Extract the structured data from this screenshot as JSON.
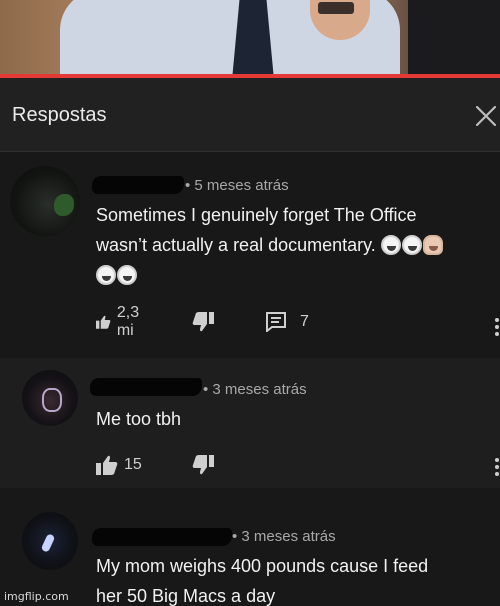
{
  "panel": {
    "title": "Respostas"
  },
  "comments": [
    {
      "meta": "• 5 meses atrás",
      "text_line1": "Sometimes I genuinely forget The Office",
      "text_line2": "wasn’t actually a real documentary.",
      "emoji": [
        "grinning-sweat-emoji",
        "grinning-sweat-emoji",
        "person-shrugging-emoji",
        "grinning-sweat-emoji",
        "grinning-sweat-emoji"
      ],
      "likes": "2,3 mi",
      "replies": "7"
    },
    {
      "meta": "• 3 meses atrás",
      "text_line1": "Me too tbh",
      "likes": "15"
    },
    {
      "meta": "• 3 meses atrás",
      "text_line1": "My mom weighs 400 pounds cause I feed",
      "text_line2": "her 50 Big Macs a day"
    }
  ],
  "watermark": "imgflip.com",
  "colors": {
    "background": "#181818",
    "header": "#212121",
    "progress": "#e53935",
    "text": "#f1f1f1",
    "meta_text": "#a8a8a8"
  }
}
